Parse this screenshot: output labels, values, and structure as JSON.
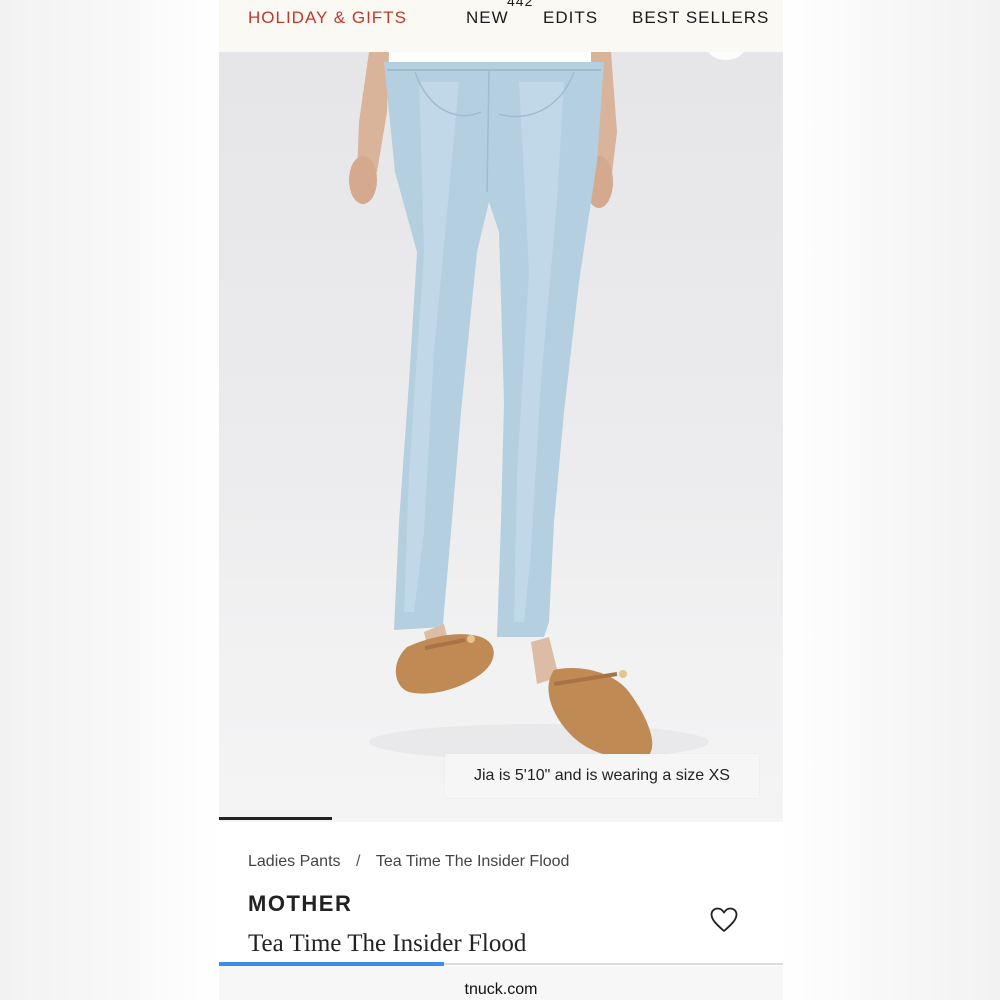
{
  "nav": {
    "holiday": "HOLIDAY & GIFTS",
    "new": "NEW",
    "count": "442",
    "edits": "EDITS",
    "best_sellers": "BEST SELLERS"
  },
  "hero": {
    "caption": "Jia is 5'10\" and is wearing a size XS"
  },
  "breadcrumb": {
    "category": "Ladies Pants",
    "separator": "/",
    "current": "Tea Time The Insider Flood"
  },
  "product": {
    "brand": "MOTHER",
    "title": "Tea Time The Insider Flood",
    "wishlist_icon": "heart-icon"
  },
  "browser": {
    "url": "tnuck.com"
  },
  "colors": {
    "accent_red": "#c0392b",
    "progress_blue": "#3d8ee8",
    "denim": "#b4cfe0",
    "shoe": "#c08a55"
  }
}
